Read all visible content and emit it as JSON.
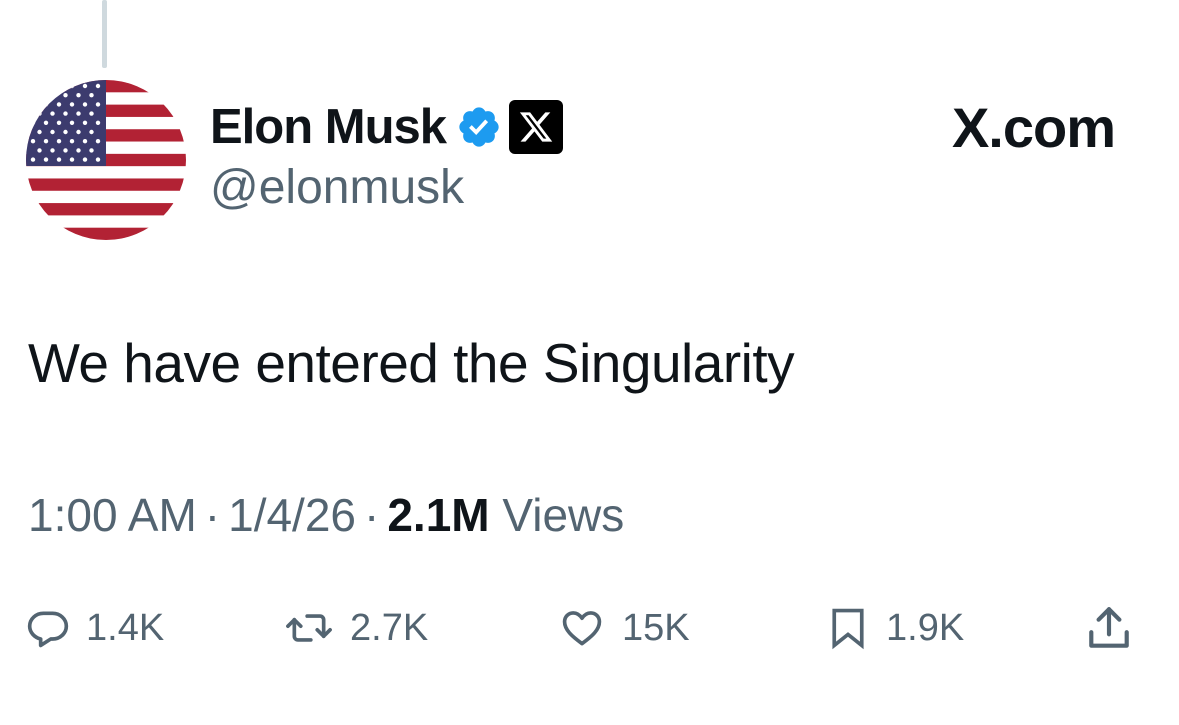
{
  "author": {
    "display_name": "Elon Musk",
    "handle": "@elonmusk",
    "avatar": "us-flag-avatar",
    "verified_icon": "verified-badge-icon",
    "affiliation_icon": "x-logo-icon"
  },
  "header": {
    "brand_label": "X.com",
    "brand_icon": "x-logo-icon"
  },
  "tweet": {
    "text": "We have entered the Singularity",
    "time": "1:00 AM",
    "date": "1/4/26",
    "separator": "·",
    "views_count": "2.1M",
    "views_label": "Views"
  },
  "actions": {
    "reply": {
      "icon": "reply-icon",
      "count": "1.4K"
    },
    "repost": {
      "icon": "repost-icon",
      "count": "2.7K"
    },
    "like": {
      "icon": "heart-icon",
      "count": "15K"
    },
    "bookmark": {
      "icon": "bookmark-icon",
      "count": "1.9K"
    },
    "share": {
      "icon": "share-icon"
    }
  },
  "colors": {
    "primary_text": "#0f1419",
    "secondary_text": "#536471",
    "verified_blue": "#1d9bf0",
    "flag_red": "#b22234",
    "flag_blue": "#3c3b6e"
  }
}
